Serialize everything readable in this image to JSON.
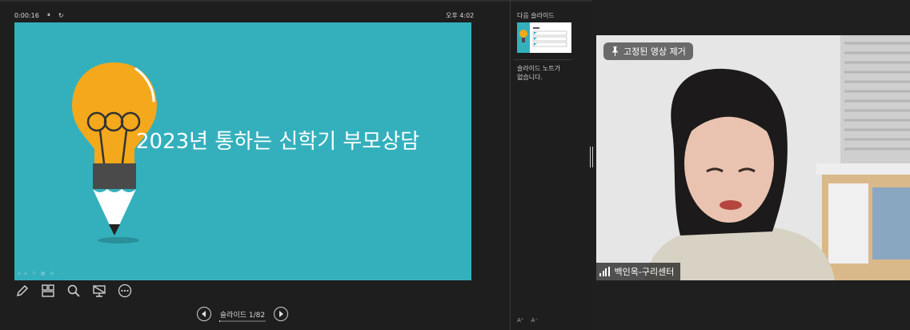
{
  "presenter": {
    "timer": "0:00:16",
    "pause_icon": "pause-icon",
    "restart_icon": "restart-icon",
    "clock": "오후 4:02"
  },
  "slide": {
    "title": "2023년 통하는 신학기 부모상담",
    "background": "#34b0bd",
    "bulb_color": "#f4a81b",
    "pencil_color": "#4a4a4a"
  },
  "toolbar": {
    "icons": [
      "pen-icon",
      "all-slides-icon",
      "zoom-icon",
      "screen-icon",
      "more-options-icon"
    ]
  },
  "nav": {
    "slide_counter": "슬라이드 1/82",
    "progress": 0.012
  },
  "next_slide": {
    "label": "다음 슬라이드"
  },
  "notes": {
    "text": "슬라이드 노트가 없습니다."
  },
  "video": {
    "unpin_label": "고정된 영상 제거",
    "participant_name": "백인옥-구리센터"
  }
}
